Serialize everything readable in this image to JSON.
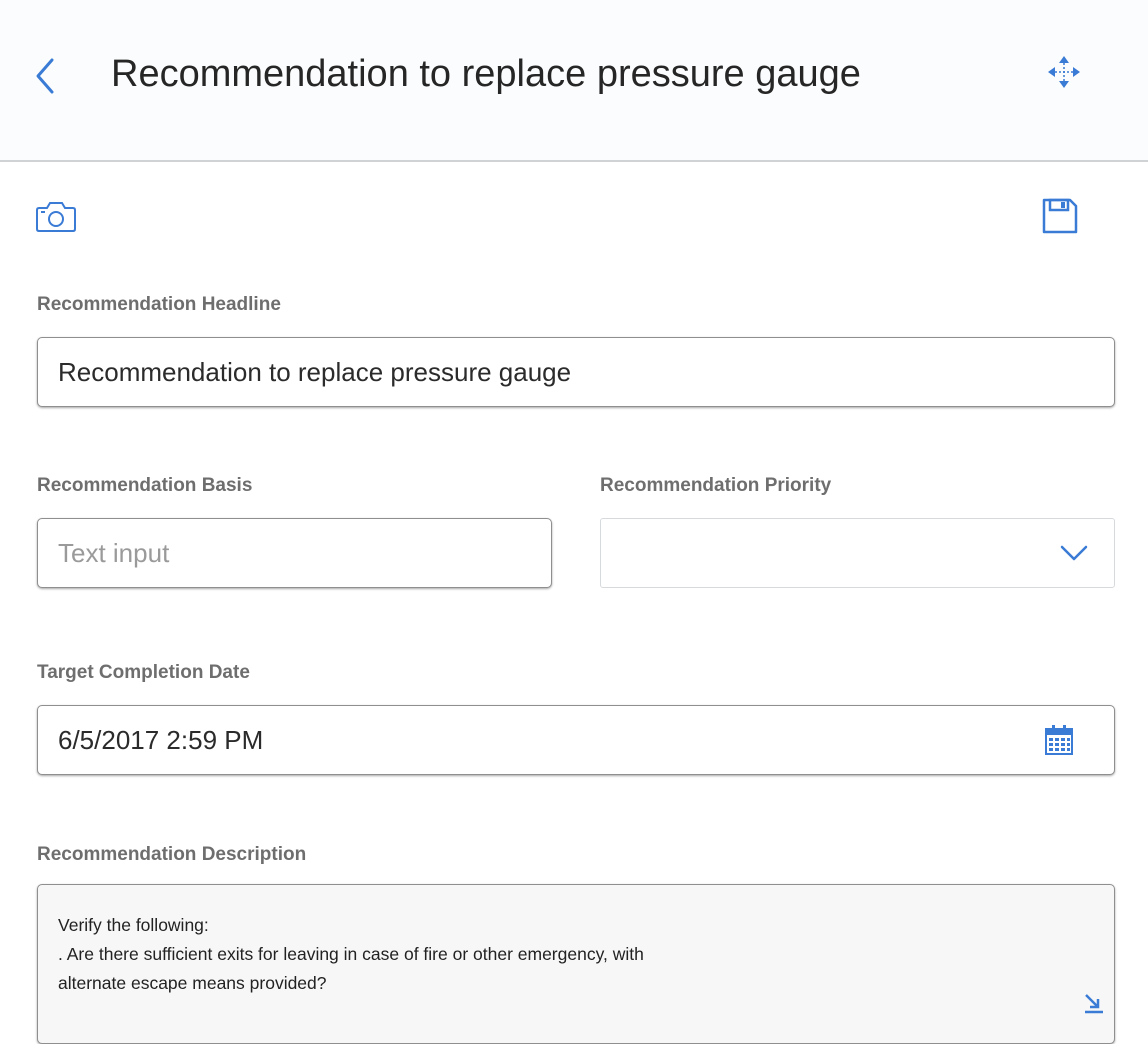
{
  "header": {
    "title": "Recommendation to replace pressure gauge"
  },
  "icons": {
    "back": "chevron-left-icon",
    "move": "move-arrows-icon",
    "camera": "camera-icon",
    "save": "save-disk-icon",
    "calendar": "calendar-icon",
    "dropdown": "chevron-down-icon",
    "resize": "resize-corner-icon"
  },
  "colors": {
    "accent": "#3a7bd5",
    "label": "#6e6e6e"
  },
  "form": {
    "headline": {
      "label": "Recommendation Headline",
      "value": "Recommendation to replace pressure gauge"
    },
    "basis": {
      "label": "Recommendation Basis",
      "value": "",
      "placeholder": "Text input"
    },
    "priority": {
      "label": "Recommendation Priority",
      "selected": ""
    },
    "target_date": {
      "label": "Target Completion Date",
      "value": "6/5/2017 2:59 PM"
    },
    "description": {
      "label": "Recommendation Description",
      "value": "Verify the following:\n. Are there sufficient exits for leaving in case of fire or other emergency, with\nalternate escape means provided?"
    }
  }
}
